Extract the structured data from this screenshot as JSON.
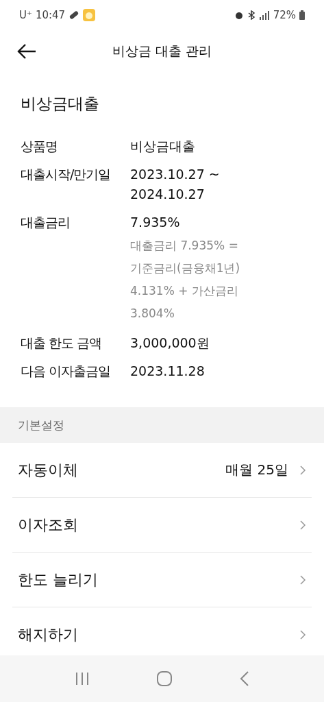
{
  "status_bar": {
    "carrier": "U⁺",
    "time": "10:47",
    "battery": "72%"
  },
  "header": {
    "title": "비상금 대출 관리"
  },
  "loan": {
    "title": "비상금대출",
    "rows": [
      {
        "label": "상품명",
        "value": "비상금대출"
      },
      {
        "label": "대출시작/만기일",
        "value": "2023.10.27 ~ 2024.10.27"
      },
      {
        "label": "대출금리",
        "value": "7.935%",
        "note": "대출금리 7.935% = 기준금리(금융채1년) 4.131% + 가산금리 3.804%"
      },
      {
        "label": "대출 한도 금액",
        "value": "3,000,000원"
      },
      {
        "label": "다음 이자출금일",
        "value": "2023.11.28"
      }
    ]
  },
  "settings": {
    "title": "기본설정",
    "items": [
      {
        "label": "자동이체",
        "value": "매월 25일"
      },
      {
        "label": "이자조회"
      },
      {
        "label": "한도 늘리기"
      },
      {
        "label": "해지하기"
      }
    ]
  }
}
